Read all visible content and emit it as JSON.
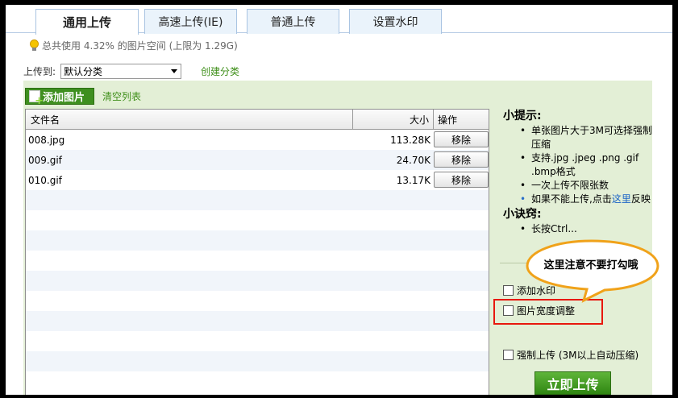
{
  "tabs": [
    {
      "label": "通用上传",
      "active": true
    },
    {
      "label": "高速上传(IE)",
      "active": false
    },
    {
      "label": "普通上传",
      "active": false
    },
    {
      "label": "设置水印",
      "active": false
    }
  ],
  "quota": {
    "text": "总共使用 4.32% 的图片空间 (上限为 1.29G)"
  },
  "upload_to": {
    "label": "上传到:",
    "selected": "默认分类",
    "create_link": "创建分类"
  },
  "toolbar": {
    "add_label": "添加图片",
    "clear_label": "清空列表"
  },
  "table": {
    "headers": {
      "name": "文件名",
      "size": "大小",
      "action": "操作"
    },
    "rows": [
      {
        "name": "008.jpg",
        "size": "113.28K",
        "action": "移除"
      },
      {
        "name": "009.gif",
        "size": "24.70K",
        "action": "移除"
      },
      {
        "name": "010.gif",
        "size": "13.17K",
        "action": "移除"
      }
    ]
  },
  "tips": {
    "title": "小提示:",
    "items": [
      "单张图片大于3M可选择强制压缩",
      "支持.jpg .jpeg .png .gif .bmp格式",
      "一次上传不限张数"
    ],
    "feedback_prefix": "如果不能上传,点击",
    "feedback_link": "这里",
    "feedback_suffix": "反映",
    "tricks_title": "小诀窍:",
    "tricks_item": "长按Ctrl..."
  },
  "options": {
    "watermark": "添加水印",
    "width_adjust": "图片宽度调整",
    "force_upload": "强制上传 (3M以上自动压缩)"
  },
  "callout": {
    "text": "这里注意不要打勾哦"
  },
  "submit": {
    "label": "立即上传"
  },
  "colors": {
    "accent_green": "#3e8f1f",
    "highlight_red": "#e8180e",
    "bubble_orange": "#f0a21a"
  }
}
